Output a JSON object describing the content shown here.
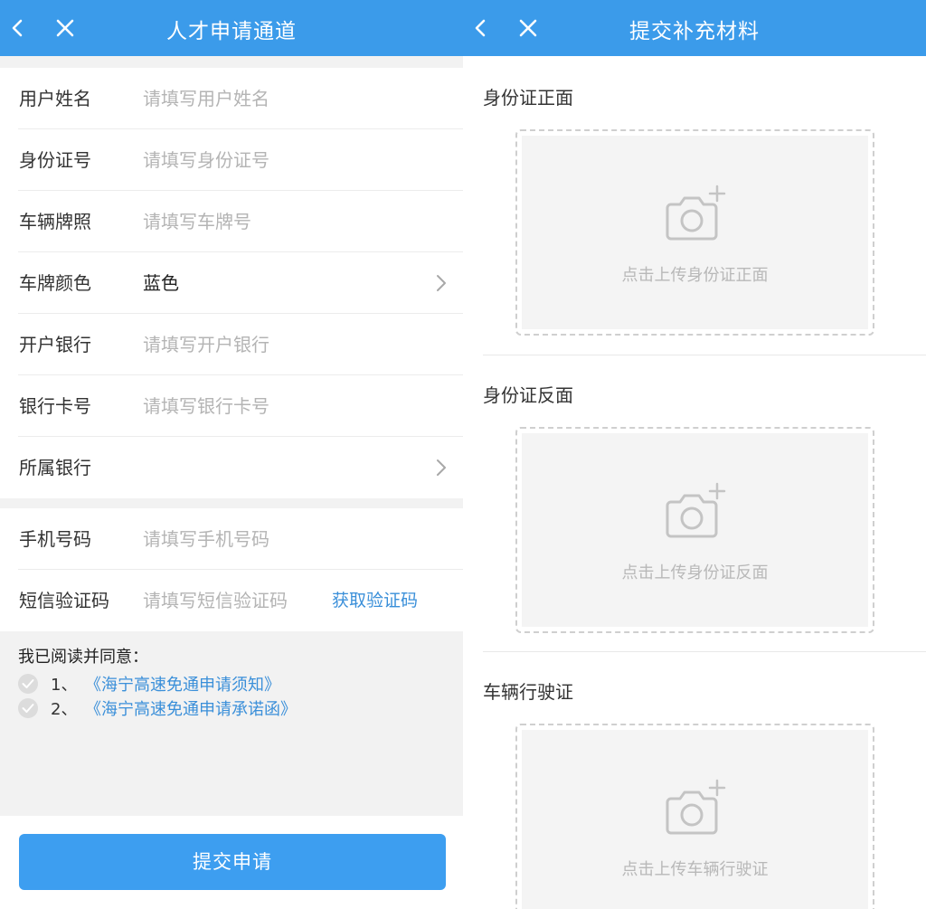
{
  "left_screen": {
    "title": "人才申请通道",
    "form_fields": [
      {
        "label": "用户姓名",
        "placeholder": "请填写用户姓名"
      },
      {
        "label": "身份证号",
        "placeholder": "请填写身份证号"
      },
      {
        "label": "车辆牌照",
        "placeholder": "请填写车牌号"
      },
      {
        "label": "车牌颜色",
        "value": "蓝色"
      },
      {
        "label": "开户银行",
        "placeholder": "请填写开户银行"
      },
      {
        "label": "银行卡号",
        "placeholder": "请填写银行卡号"
      },
      {
        "label": "所属银行",
        "value": ""
      }
    ],
    "contact_fields": [
      {
        "label": "手机号码",
        "placeholder": "请填写手机号码"
      },
      {
        "label": "短信验证码",
        "placeholder": "请填写短信验证码",
        "action": "获取验证码"
      }
    ],
    "agreement": {
      "title": "我已阅读并同意：",
      "items": [
        {
          "number": "1、",
          "link": "《海宁高速免通申请须知》"
        },
        {
          "number": "2、",
          "link": "《海宁高速免通申请承诺函》"
        }
      ]
    },
    "submit_label": "提交申请"
  },
  "right_screen": {
    "title": "提交补充材料",
    "sections": [
      {
        "title": "身份证正面",
        "hint": "点击上传身份证正面"
      },
      {
        "title": "身份证反面",
        "hint": "点击上传身份证反面"
      },
      {
        "title": "车辆行驶证",
        "hint": "点击上传车辆行驶证"
      }
    ]
  },
  "colors": {
    "nav_bar": "#3b9bea",
    "link": "#3a8fd9",
    "placeholder": "#b4b4b4",
    "page_background": "#f2f2f2"
  },
  "icons": {
    "back": "chevron-left-icon",
    "close": "close-icon",
    "disclosure": "chevron-right-icon",
    "upload": "camera-plus-icon",
    "agree": "check-circle-icon"
  }
}
